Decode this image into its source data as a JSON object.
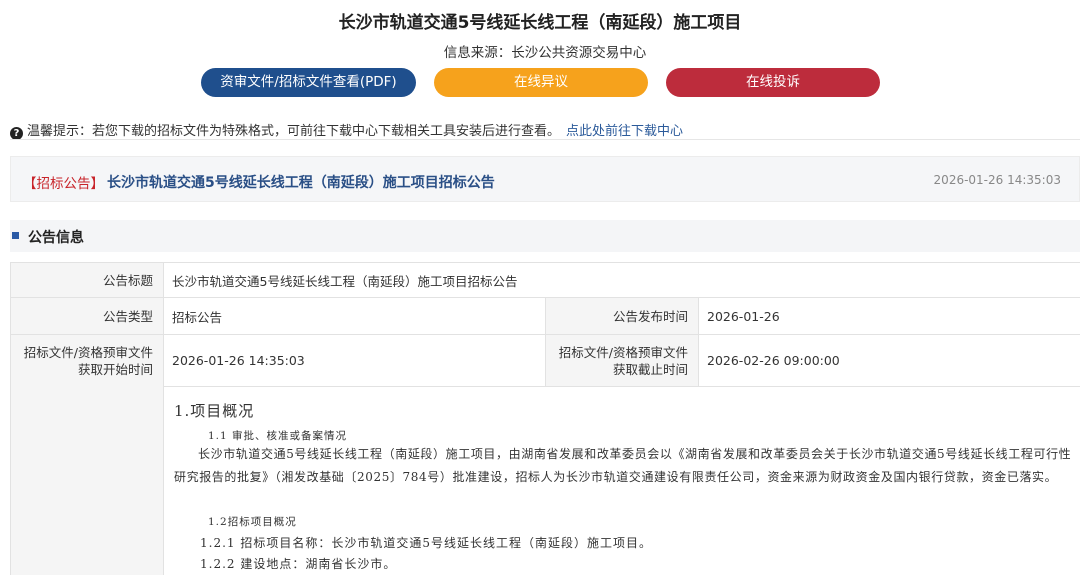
{
  "page": {
    "title": "长沙市轨道交通5号线延长线工程（南延段）施工项目",
    "source": "信息来源：长沙公共资源交易中心"
  },
  "buttons": {
    "doc_view": "资审文件/招标文件查看(PDF)",
    "objection": "在线异议",
    "complaint": "在线投诉"
  },
  "tip": {
    "text": "温馨提示：若您下载的招标文件为特殊格式，可前往下载中心下载相关工具安装后进行查看。",
    "link": "点此处前往下载中心"
  },
  "notice": {
    "tag": "【招标公告】",
    "title": "长沙市轨道交通5号线延长线工程（南延段）施工项目招标公告",
    "date": "2026-01-26 14:35:03"
  },
  "section": {
    "title": "公告信息"
  },
  "info": {
    "title_label": "公告标题",
    "title_value": "长沙市轨道交通5号线延长线工程（南延段）施工项目招标公告",
    "type_label": "公告类型",
    "type_value": "招标公告",
    "publish_label": "公告发布时间",
    "publish_value": "2026-01-26",
    "start_label_1": "招标文件/资格预审文件",
    "start_label_2": "获取开始时间",
    "start_value": "2026-01-26 14:35:03",
    "end_label_1": "招标文件/资格预审文件",
    "end_label_2": "获取截止时间",
    "end_value": "2026-02-26 09:00:00"
  },
  "content": {
    "heading": "1.项目概况",
    "sub_1_1": "1.1 审批、核准或备案情况",
    "para": "长沙市轨道交通5号线延长线工程（南延段）施工项目，由湖南省发展和改革委员会以《湖南省发展和改革委员会关于长沙市轨道交通5号线延长线工程可行性研究报告的批复》（湘发改基础〔2025〕784号）批准建设，招标人为长沙市轨道交通建设有限责任公司，资金来源为财政资金及国内银行贷款，资金已落实。",
    "sub_1_2": "1.2招标项目概况",
    "sub_1_2_1": "1.2.1 招标项目名称：长沙市轨道交通5号线延长线工程（南延段）施工项目。",
    "sub_1_2_2": "1.2.2 建设地点：湖南省长沙市。"
  }
}
